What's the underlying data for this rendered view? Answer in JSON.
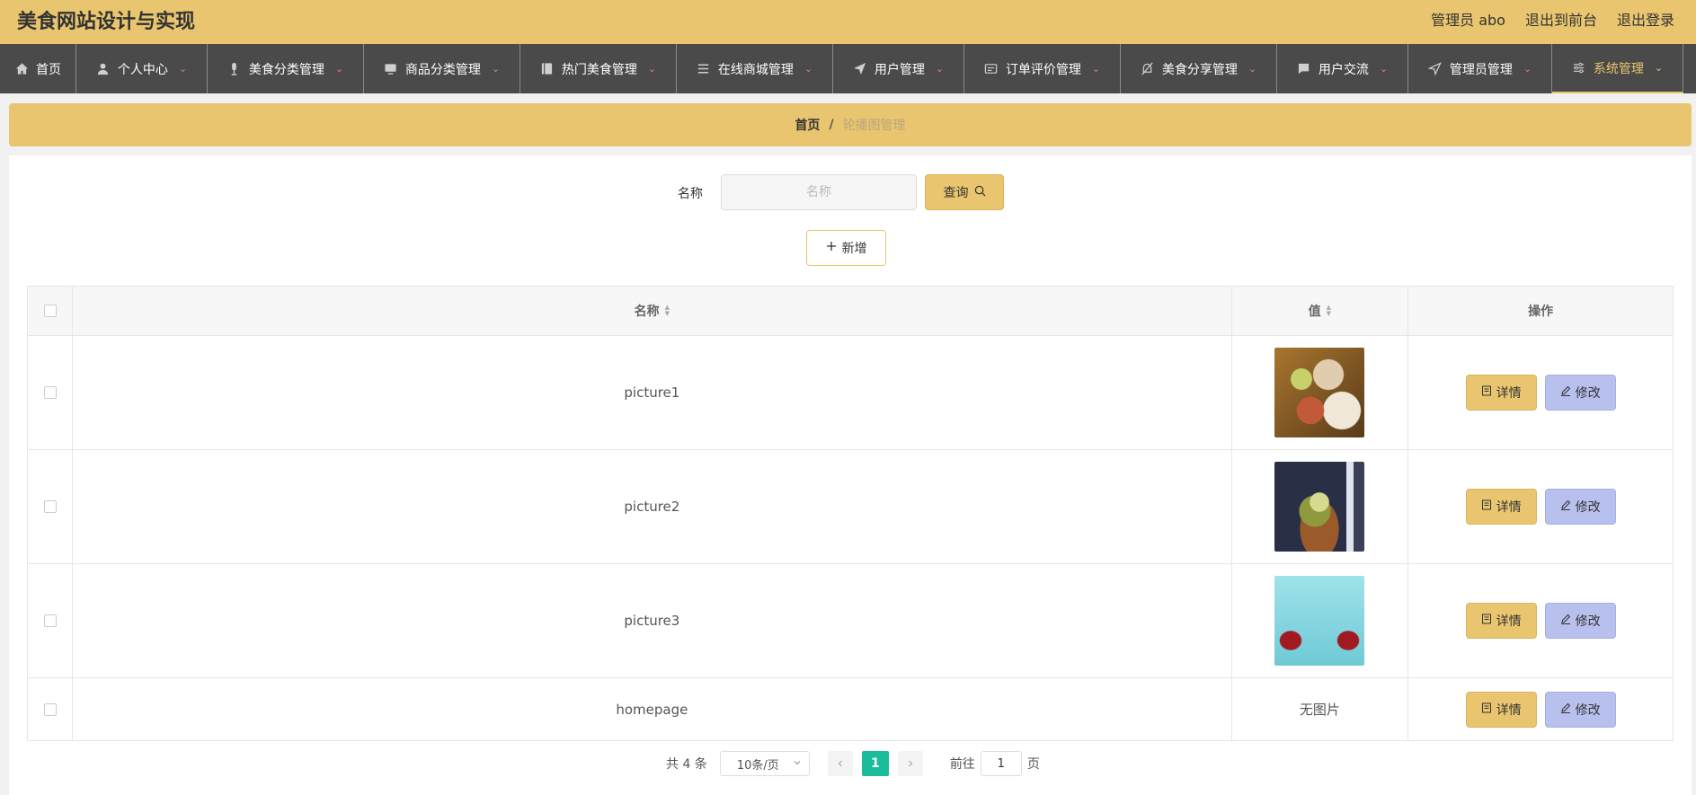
{
  "app": {
    "title": "美食网站设计与实现",
    "user_label": "管理员 abo",
    "to_front": "退出到前台",
    "logout": "退出登录"
  },
  "nav": [
    {
      "label": "首页",
      "icon": "home-icon"
    },
    {
      "label": "个人中心",
      "icon": "user-icon"
    },
    {
      "label": "美食分类管理",
      "icon": "mic-icon"
    },
    {
      "label": "商品分类管理",
      "icon": "monitor-icon"
    },
    {
      "label": "热门美食管理",
      "icon": "book-icon"
    },
    {
      "label": "在线商城管理",
      "icon": "list-icon"
    },
    {
      "label": "用户管理",
      "icon": "send-icon"
    },
    {
      "label": "订单评价管理",
      "icon": "card-icon"
    },
    {
      "label": "美食分享管理",
      "icon": "bell-off-icon"
    },
    {
      "label": "用户交流",
      "icon": "chat-icon"
    },
    {
      "label": "管理员管理",
      "icon": "navigation-icon"
    },
    {
      "label": "系统管理",
      "icon": "sliders-icon",
      "active": true
    }
  ],
  "breadcrumb": {
    "home": "首页",
    "separator": "/",
    "current": "轮播图管理"
  },
  "search": {
    "label": "名称",
    "placeholder": "名称",
    "value": "",
    "button": "查询"
  },
  "add_button": "新增",
  "table": {
    "headers": {
      "name": "名称",
      "value": "值",
      "actions": "操作"
    },
    "rows": [
      {
        "name": "picture1",
        "image": "thumb1",
        "no_image_text": ""
      },
      {
        "name": "picture2",
        "image": "thumb2",
        "no_image_text": ""
      },
      {
        "name": "picture3",
        "image": "thumb3",
        "no_image_text": ""
      },
      {
        "name": "homepage",
        "image": "",
        "no_image_text": "无图片"
      }
    ],
    "detail_label": "详情",
    "edit_label": "修改"
  },
  "pagination": {
    "total": "共 4 条",
    "page_size": "10条/页",
    "current_page": "1",
    "goto_label": "前往",
    "goto_value": "1",
    "page_unit": "页"
  },
  "colors": {
    "accent": "#e8c56e",
    "nav_bg": "#4a4a4a",
    "edit_button": "#b8c0ee",
    "pager_active": "#1abc9c"
  }
}
